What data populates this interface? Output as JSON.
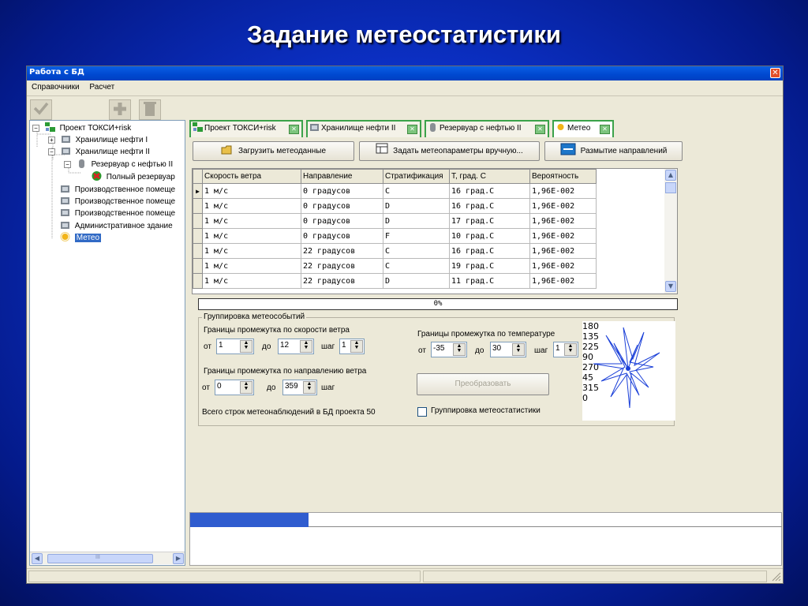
{
  "slide": {
    "title": "Задание метеостатистики"
  },
  "window": {
    "title": "Работа с БД",
    "close_glyph": "✕"
  },
  "menu": {
    "items": [
      "Справочники",
      "Расчет"
    ]
  },
  "toolbar": {
    "icons": [
      "checkmark-icon",
      "plus-icon",
      "trash-icon"
    ]
  },
  "tree": {
    "nodes": [
      {
        "label": "Проект ТОКСИ+risk",
        "expander": "−",
        "icon": "project-icon"
      },
      {
        "label": "Хранилище нефти I",
        "expander": "+",
        "icon": "storage-icon"
      },
      {
        "label": "Хранилище нефти II",
        "expander": "−",
        "icon": "storage-icon"
      },
      {
        "label": "Резервуар с нефтью II",
        "expander": "−",
        "icon": "tank-icon"
      },
      {
        "label": "Полный резервуар",
        "expander": "",
        "icon": "target-icon"
      },
      {
        "label": "Производственное помеще",
        "expander": "",
        "icon": "building-icon"
      },
      {
        "label": "Производственное помеще",
        "expander": "",
        "icon": "building-icon"
      },
      {
        "label": "Производственное помеще",
        "expander": "",
        "icon": "building-icon"
      },
      {
        "label": "Административное здание",
        "expander": "",
        "icon": "building-icon"
      },
      {
        "label": "Метео",
        "expander": "",
        "icon": "sun-icon",
        "selected": true
      }
    ],
    "scroll_grip": "III"
  },
  "tabs": [
    {
      "label": "Проект ТОКСИ+risk"
    },
    {
      "label": "Хранилище нефти II"
    },
    {
      "label": "Резервуар с нефтью II"
    },
    {
      "label": "Метео",
      "active": true
    }
  ],
  "buttons": {
    "load": "Загрузить метеоданные",
    "manual": "Задать метеопараметры вручную...",
    "blur": "Размытие направлений"
  },
  "grid": {
    "columns": [
      "Скорость ветра",
      "Направление",
      "Стратификация",
      "T, град. C",
      "Вероятность"
    ],
    "rows": [
      [
        "1 м/с",
        "0 градусов",
        "C",
        "16 град.C",
        "1,96E-002"
      ],
      [
        "1 м/с",
        "0 градусов",
        "D",
        "16 град.C",
        "1,96E-002"
      ],
      [
        "1 м/с",
        "0 градусов",
        "D",
        "17 град.C",
        "1,96E-002"
      ],
      [
        "1 м/с",
        "0 градусов",
        "F",
        "10 град.C",
        "1,96E-002"
      ],
      [
        "1 м/с",
        "22 градусов",
        "C",
        "16 град.C",
        "1,96E-002"
      ],
      [
        "1 м/с",
        "22 градусов",
        "C",
        "19 град.C",
        "1,96E-002"
      ],
      [
        "1 м/с",
        "22 градусов",
        "D",
        "11 град.C",
        "1,96E-002"
      ]
    ]
  },
  "progress": {
    "text": "0%",
    "value": 0
  },
  "grouping": {
    "legend": "Группировка метеособытий",
    "speed_label": "Границы промежутка по скорости ветра",
    "speed_from": "1",
    "speed_to": "12",
    "speed_step": "1",
    "dir_label": "Границы промежутка по направлению ветра",
    "dir_from": "0",
    "dir_to": "359",
    "temp_label": "Границы промежутка по температуре",
    "temp_from": "-35",
    "temp_to": "30",
    "temp_step": "1",
    "from": "от",
    "to": "до",
    "step": "шаг",
    "total": "Всего строк метеонаблюдений в БД проекта 50",
    "convert": "Преобразовать",
    "checkbox_label": "Группировка метеостатистики",
    "checkbox_checked": false
  },
  "wind_rose": {
    "labels": [
      "180",
      "135",
      "225",
      "90",
      "270",
      "45",
      "315",
      "0"
    ]
  }
}
